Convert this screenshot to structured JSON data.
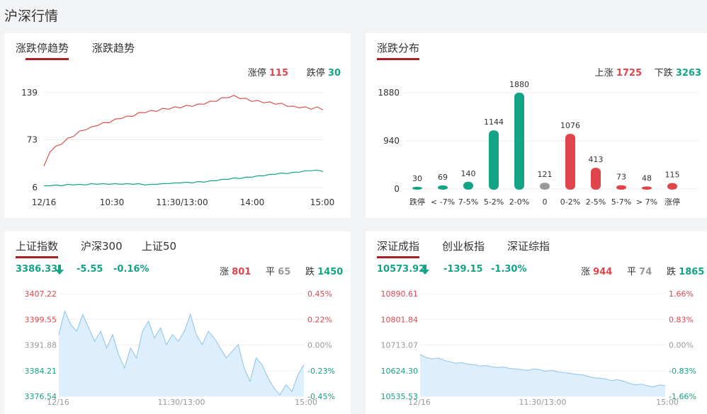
{
  "page": {
    "title": "沪深行情"
  },
  "limit_panel": {
    "tabs": [
      "涨跌停趋势",
      "涨跌趋势"
    ],
    "up_label": "涨停",
    "up_count": "115",
    "down_label": "跌停",
    "down_count": "30",
    "y_ticks": [
      "139",
      "73",
      "6"
    ],
    "x_ticks": [
      "12/16",
      "10:30",
      "11:30/13:00",
      "14:00",
      "15:00"
    ],
    "colors": {
      "up": "#d9534f",
      "down": "#13a385"
    }
  },
  "dist_panel": {
    "tab": "涨跌分布",
    "up_label": "上涨",
    "up_count": "1725",
    "down_label": "下跌",
    "down_count": "3263",
    "y_ticks": [
      "1880",
      "940",
      "0"
    ]
  },
  "sh_panel": {
    "tabs": [
      "上证指数",
      "沪深300",
      "上证50"
    ],
    "price": "3386.33",
    "change": "-5.55",
    "change_pct": "-0.16%",
    "up_label": "涨",
    "up_count": "801",
    "flat_label": "平",
    "flat_count": "65",
    "down_label": "跌",
    "down_count": "1450",
    "price_ticks": [
      "3407.22",
      "3399.55",
      "3391.88",
      "3384.21",
      "3376.54"
    ],
    "pct_ticks": [
      "0.45%",
      "0.22%",
      "0.00%",
      "-0.23%",
      "-0.45%"
    ],
    "x_ticks": [
      "12/16",
      "11:30/13:00",
      "15:00"
    ]
  },
  "sz_panel": {
    "tabs": [
      "深证成指",
      "创业板指",
      "深证综指"
    ],
    "price": "10573.92",
    "change": "-139.15",
    "change_pct": "-1.30%",
    "up_label": "涨",
    "up_count": "944",
    "flat_label": "平",
    "flat_count": "74",
    "down_label": "跌",
    "down_count": "1865",
    "price_ticks": [
      "10890.61",
      "10801.84",
      "10713.07",
      "10624.30",
      "10535.53"
    ],
    "pct_ticks": [
      "1.66%",
      "0.83%",
      "0.00%",
      "-0.83%",
      "-1.66%"
    ],
    "x_ticks": [
      "12/16",
      "11:30/13:00",
      "15:00"
    ]
  },
  "chart_data": [
    {
      "type": "line",
      "series": [
        {
          "name": "涨停",
          "values": [
            35,
            57,
            63,
            68,
            74,
            79,
            84,
            88,
            90,
            94,
            96,
            98,
            101,
            104,
            105,
            107,
            110,
            112,
            113,
            114,
            116,
            117,
            118,
            119,
            120,
            121,
            122,
            124,
            126,
            128,
            131,
            133,
            134,
            132,
            130,
            128,
            127,
            126,
            125,
            124,
            123,
            121,
            119,
            119,
            118,
            117,
            118,
            116
          ]
        },
        {
          "name": "跌停",
          "values": [
            8,
            9,
            9,
            9,
            10,
            10,
            10,
            10,
            11,
            11,
            11,
            11,
            11,
            11,
            11,
            11,
            11,
            10,
            10,
            11,
            11,
            12,
            12,
            13,
            13,
            13,
            14,
            14,
            15,
            16,
            17,
            18,
            19,
            19,
            20,
            21,
            22,
            23,
            24,
            25,
            26,
            26,
            27,
            28,
            29,
            30,
            30,
            29
          ]
        }
      ],
      "ylim": [
        6,
        139
      ]
    },
    {
      "type": "bar",
      "categories": [
        "跌停",
        "< -7%",
        "7-5%",
        "5-2%",
        "2-0%",
        "0",
        "0-2%",
        "2-5%",
        "5-7%",
        "> 7%",
        "涨停"
      ],
      "values": [
        30,
        69,
        140,
        1144,
        1880,
        121,
        1076,
        413,
        73,
        48,
        115
      ],
      "colors": [
        "#13a385",
        "#13a385",
        "#13a385",
        "#13a385",
        "#13a385",
        "#999999",
        "#e0454b",
        "#e0454b",
        "#e0454b",
        "#e0454b",
        "#e0454b"
      ],
      "ylim": [
        0,
        1880
      ]
    },
    {
      "type": "area",
      "series": [
        {
          "values": [
            3395,
            3402,
            3398,
            3396,
            3401,
            3397,
            3393,
            3396,
            3391,
            3395,
            3389,
            3385,
            3391,
            3388,
            3396,
            3399,
            3394,
            3397,
            3392,
            3395,
            3393,
            3396,
            3401,
            3395,
            3392,
            3396,
            3394,
            3391,
            3388,
            3390,
            3392,
            3385,
            3381,
            3388,
            3386,
            3382,
            3379,
            3377,
            3380,
            3378,
            3383,
            3386
          ]
        }
      ],
      "ylim": [
        3376.54,
        3407.22
      ]
    },
    {
      "type": "area",
      "series": [
        {
          "values": [
            10680,
            10670,
            10665,
            10668,
            10660,
            10655,
            10650,
            10652,
            10647,
            10645,
            10640,
            10642,
            10638,
            10635,
            10637,
            10632,
            10630,
            10628,
            10625,
            10630,
            10628,
            10622,
            10626,
            10620,
            10618,
            10615,
            10612,
            10610,
            10605,
            10600,
            10598,
            10596,
            10590,
            10593,
            10588,
            10580,
            10575,
            10578,
            10572,
            10568,
            10575,
            10573
          ]
        }
      ],
      "ylim": [
        10535.53,
        10890.61
      ]
    }
  ]
}
